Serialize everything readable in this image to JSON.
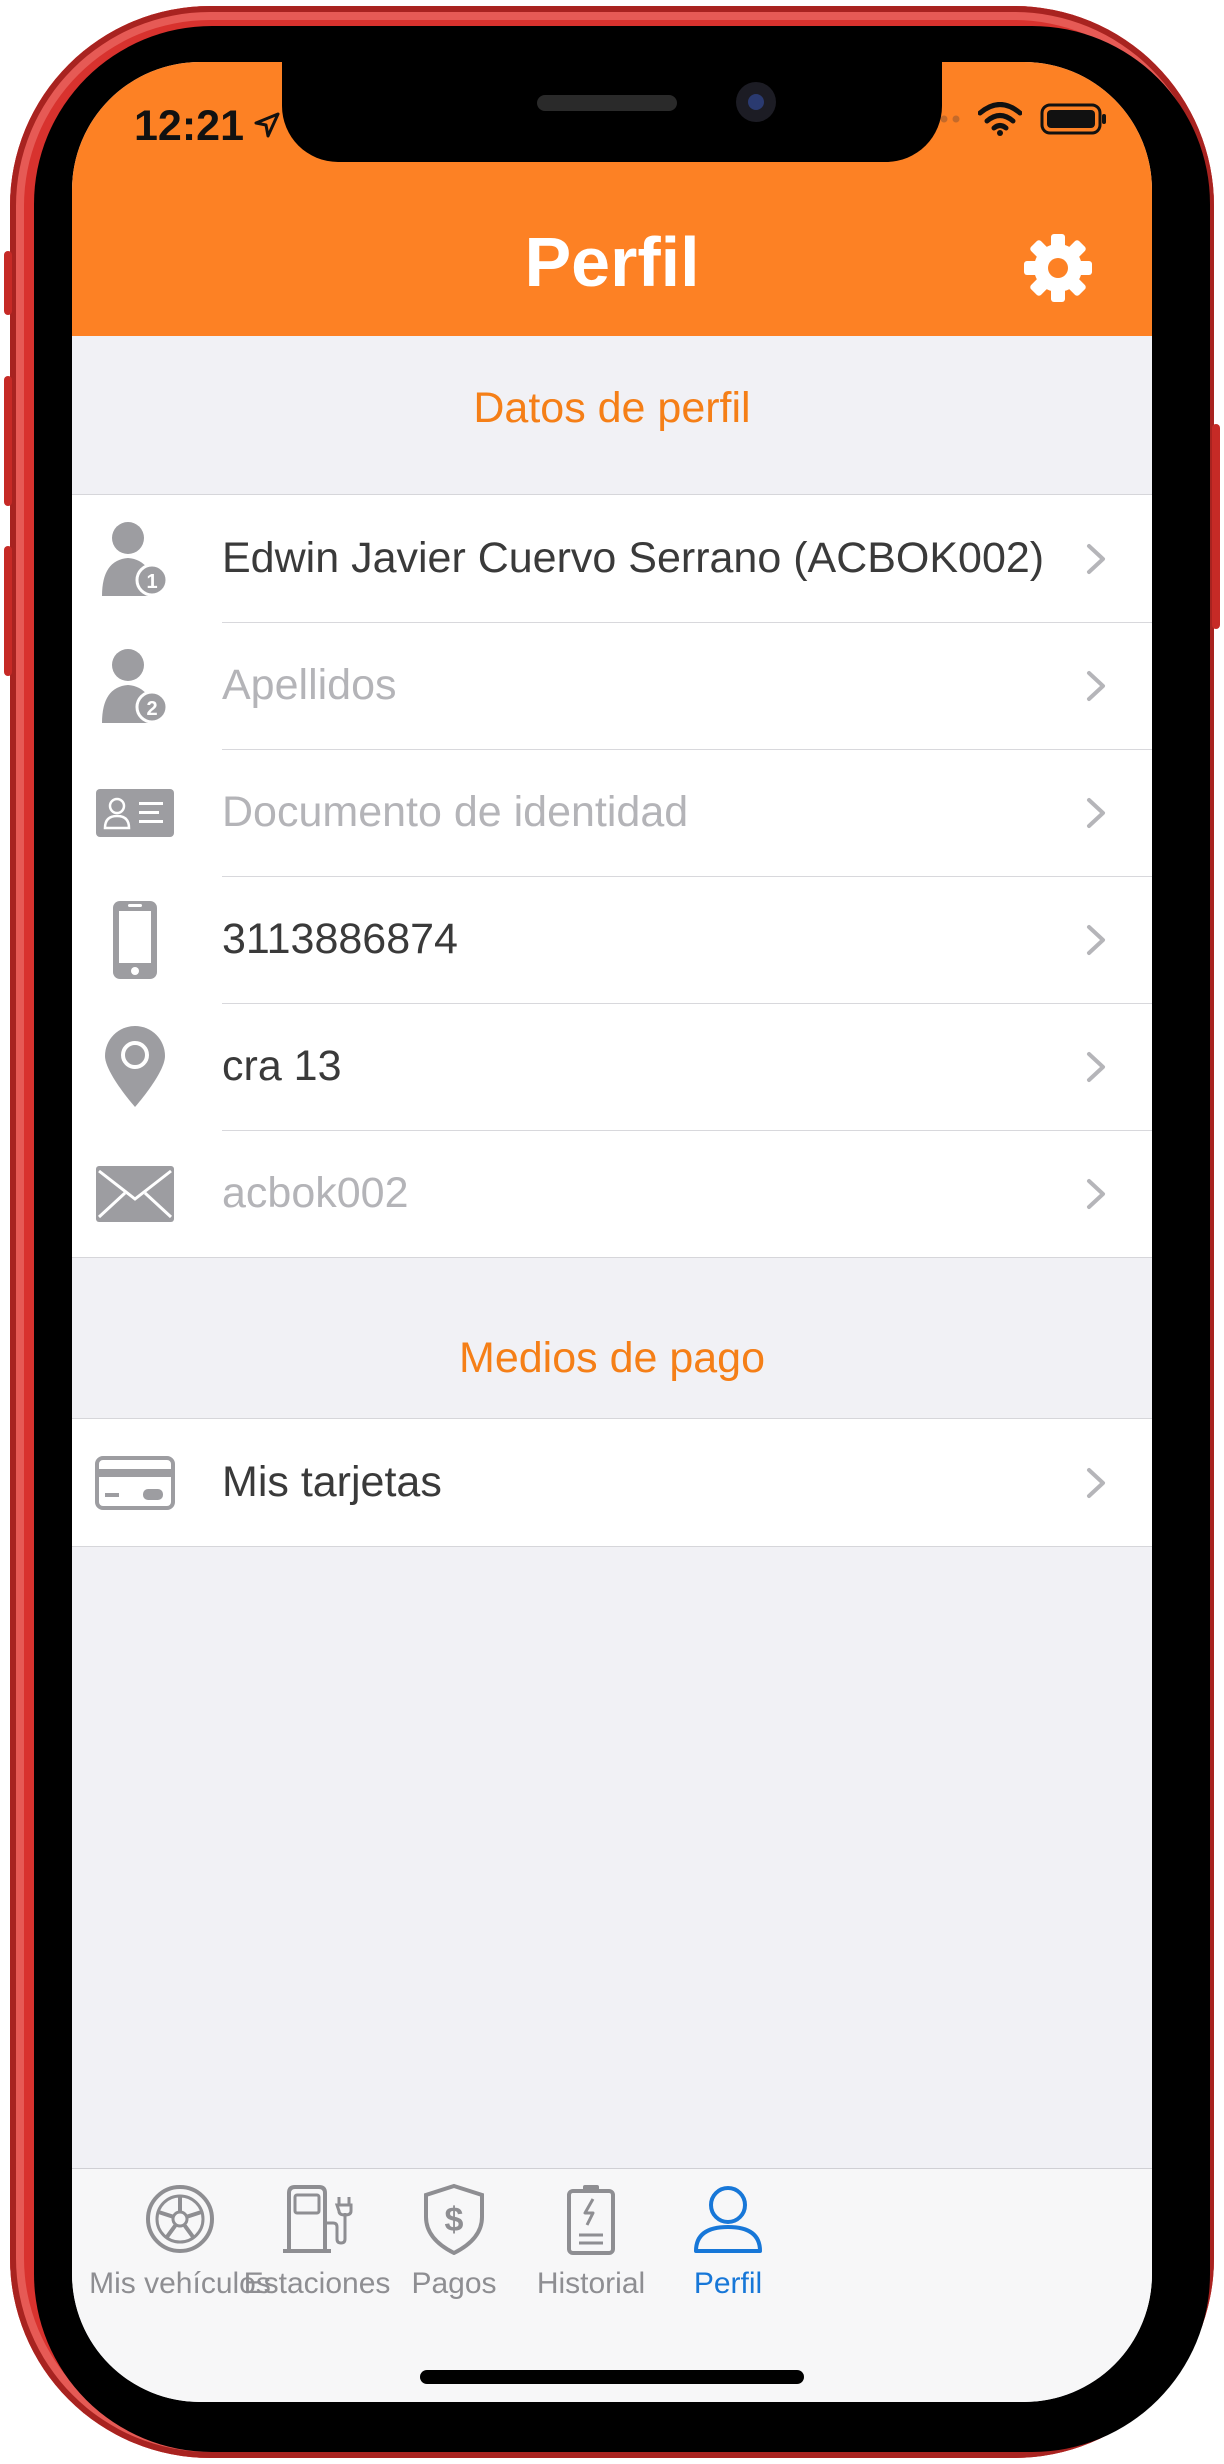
{
  "status_bar": {
    "time": "12:21"
  },
  "header": {
    "title": "Perfil",
    "settings_icon": "gear-icon"
  },
  "colors": {
    "accent": "#fd8124",
    "section_text": "#f57f17",
    "tab_active": "#1777d8",
    "frame": "#d8322e"
  },
  "profile_section": {
    "title": "Datos de perfil",
    "items": [
      {
        "icon": "user-1-icon",
        "label": "Edwin Javier Cuervo Serrano (ACBOK002)",
        "placeholder": false
      },
      {
        "icon": "user-2-icon",
        "label": "Apellidos",
        "placeholder": true
      },
      {
        "icon": "id-card-icon",
        "label": "Documento de identidad",
        "placeholder": true
      },
      {
        "icon": "phone-icon",
        "label": "3113886874",
        "placeholder": false
      },
      {
        "icon": "location-pin-icon",
        "label": "cra 13",
        "placeholder": false
      },
      {
        "icon": "envelope-icon",
        "label": "acbok002",
        "placeholder": true
      }
    ]
  },
  "payment_section": {
    "title": "Medios de pago",
    "items": [
      {
        "icon": "credit-card-icon",
        "label": "Mis tarjetas",
        "placeholder": false
      }
    ]
  },
  "tabbar": {
    "active": 4,
    "tabs": [
      {
        "label": "Mis vehículos",
        "icon": "wheel-icon"
      },
      {
        "label": "Estaciones",
        "icon": "charging-station-icon"
      },
      {
        "label": "Pagos",
        "icon": "dollar-shield-icon"
      },
      {
        "label": "Historial",
        "icon": "battery-history-icon"
      },
      {
        "label": "Perfil",
        "icon": "person-icon"
      }
    ]
  }
}
